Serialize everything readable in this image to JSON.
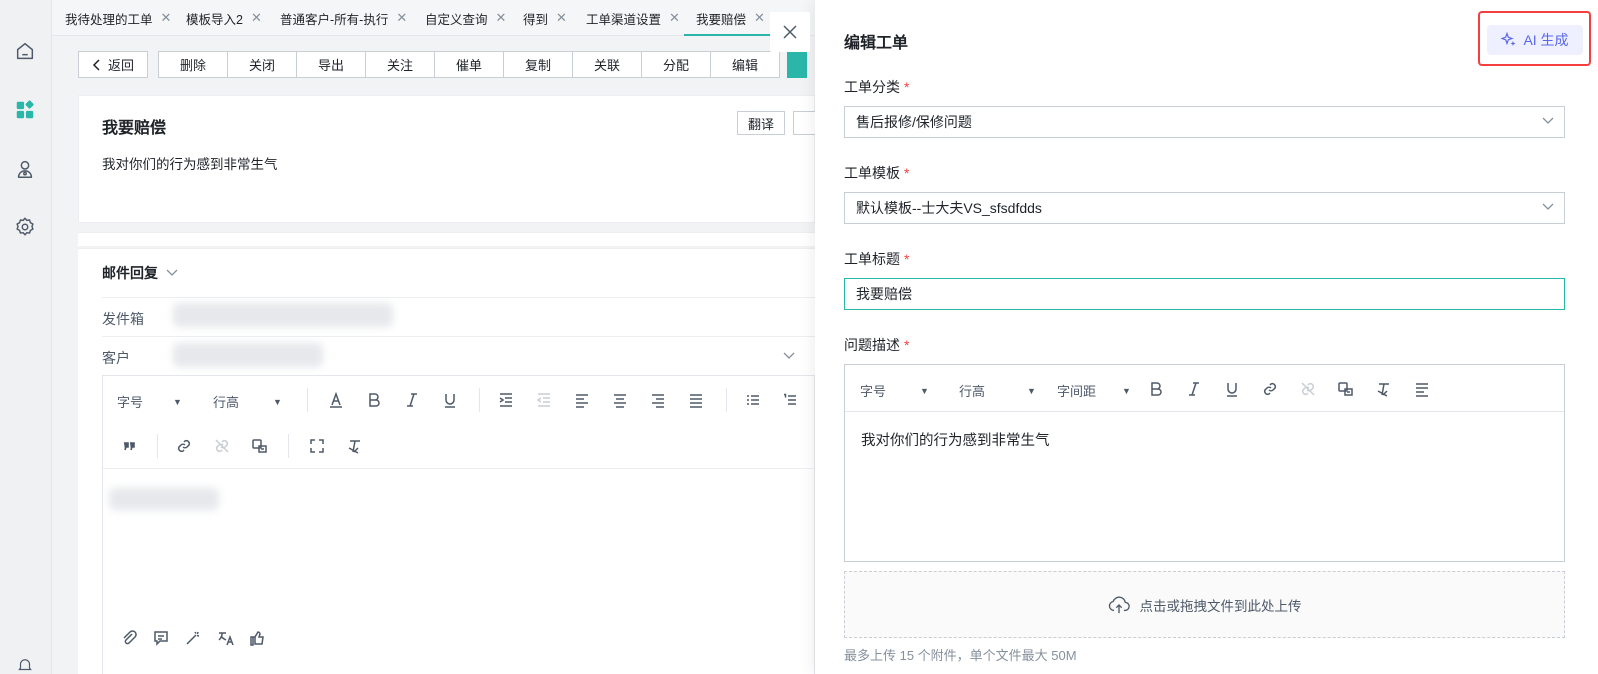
{
  "tabs": [
    {
      "label": "我待处理的工单",
      "active": false
    },
    {
      "label": "模板导入2",
      "active": false
    },
    {
      "label": "普通客户-所有-执行",
      "active": false
    },
    {
      "label": "自定义查询",
      "active": false
    },
    {
      "label": "得到",
      "active": false
    },
    {
      "label": "工单渠道设置",
      "active": false
    },
    {
      "label": "我要赔偿",
      "active": true
    }
  ],
  "toolbar": {
    "back": "返回",
    "actions": [
      "删除",
      "关闭",
      "导出",
      "关注",
      "催单",
      "复制",
      "关联",
      "分配",
      "编辑"
    ]
  },
  "ticket": {
    "title": "我要赔偿",
    "translate": "翻译",
    "description": "我对你们的行为感到非常生气"
  },
  "mail": {
    "title": "邮件回复",
    "sender_label": "发件箱",
    "customer_label": "客户",
    "toolbar_row1": [
      "font-size-select",
      "line-height-select",
      "font-color-icon",
      "bold-icon",
      "italic-icon",
      "underline-icon",
      "indent-icon",
      "outdent-icon",
      "align-left-icon",
      "align-center-icon",
      "align-right-icon",
      "align-justify-icon",
      "bullet-list-icon",
      "numbered-list-icon"
    ],
    "toolbar_row2": [
      "quote-icon",
      "link-icon",
      "unlink-icon",
      "image-text-icon",
      "fullscreen-icon",
      "clear-format-icon"
    ],
    "font_size_label": "字号",
    "line_height_label": "行高",
    "bottom_icons": [
      "attachment-icon",
      "template-icon",
      "magic-wand-icon",
      "translate-icon",
      "thumbs-up-icon"
    ]
  },
  "drawer": {
    "title": "编辑工单",
    "ai_label": "AI 生成",
    "category_label": "工单分类",
    "category_value": "售后报修/保修问题",
    "template_label": "工单模板",
    "template_value": "默认模板--士大夫VS_sfsdfdds",
    "subject_label": "工单标题",
    "subject_value": "我要赔偿",
    "desc_label": "问题描述",
    "required_mark": "*",
    "editor_font_size": "字号",
    "editor_line_height": "行高",
    "editor_letter_spacing": "字间距",
    "editor_icons": [
      "bold-icon",
      "italic-icon",
      "underline-icon",
      "link-icon",
      "unlink-icon",
      "image-text-icon",
      "clear-format-icon",
      "align-icon"
    ],
    "editor_content": "我对你们的行为感到非常生气",
    "upload_text": "点击或拖拽文件到此处上传",
    "upload_hint": "最多上传 15 个附件，单个文件最大 50M"
  },
  "colors": {
    "accent": "#2ab7a9",
    "required": "#f53f3f",
    "ai_text": "#5b67e8",
    "ai_bg": "#eef0ff",
    "highlight_outline": "#f53f3f"
  }
}
